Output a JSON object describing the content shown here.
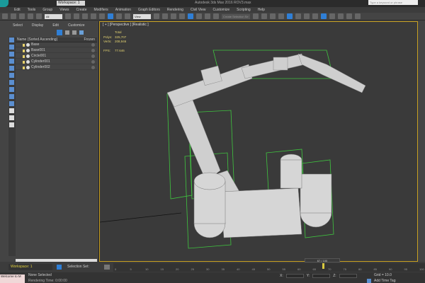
{
  "titlebar": {
    "workspace": "Workspace: 1",
    "app_title": "Autodesk 3ds Max 2016    ROV3.max",
    "search_placeholder": "Type a keyword or phrase"
  },
  "menu": [
    "Edit",
    "Tools",
    "Group",
    "Views",
    "Create",
    "Modifiers",
    "Animation",
    "Graph Editors",
    "Rendering",
    "Civil View",
    "Customize",
    "Scripting",
    "Help"
  ],
  "toolbar": {
    "filter": "All",
    "refcoord": "View",
    "named_sel": "Create Selection Se"
  },
  "explorer": {
    "menu": [
      "Select",
      "Display",
      "Edit",
      "Customize"
    ],
    "col_name": "Name (Sorted Ascending)",
    "col_frozen": "Frozen",
    "items": [
      "Base",
      "Base001",
      "Circle001",
      "Cylinder001",
      "Cylinder002"
    ]
  },
  "viewport": {
    "label": "[ + ] [Perspective ] [Realistic ]",
    "stats_header": "Total",
    "polys_label": "Polys:",
    "polys": "325,707",
    "verts_label": "Verts:",
    "verts": "208,946",
    "fps_label": "FPS:",
    "fps": "77.646"
  },
  "workspace_bar": {
    "name": "Workspace: 1",
    "selection_set": "Selection Set:"
  },
  "timeline": {
    "frame": "67 / 100",
    "ticks": [
      "0",
      "5",
      "10",
      "15",
      "20",
      "25",
      "30",
      "35",
      "40",
      "45",
      "50",
      "55",
      "60",
      "65",
      "70",
      "75",
      "80",
      "85",
      "90",
      "95",
      "100"
    ]
  },
  "status": {
    "maxscript": "Welcome to M",
    "selected": "None Selected",
    "render_time": "Rendering Time: 0:00:00",
    "grid": "Grid = 10.0",
    "add_time_tag": "Add Time Tag",
    "coord_labels": [
      "X:",
      "Y:",
      "Z:"
    ]
  },
  "colors": {
    "accent": "#2f7fd6",
    "viewport_border": "#c8a020",
    "bbox": "#3fc63f"
  }
}
